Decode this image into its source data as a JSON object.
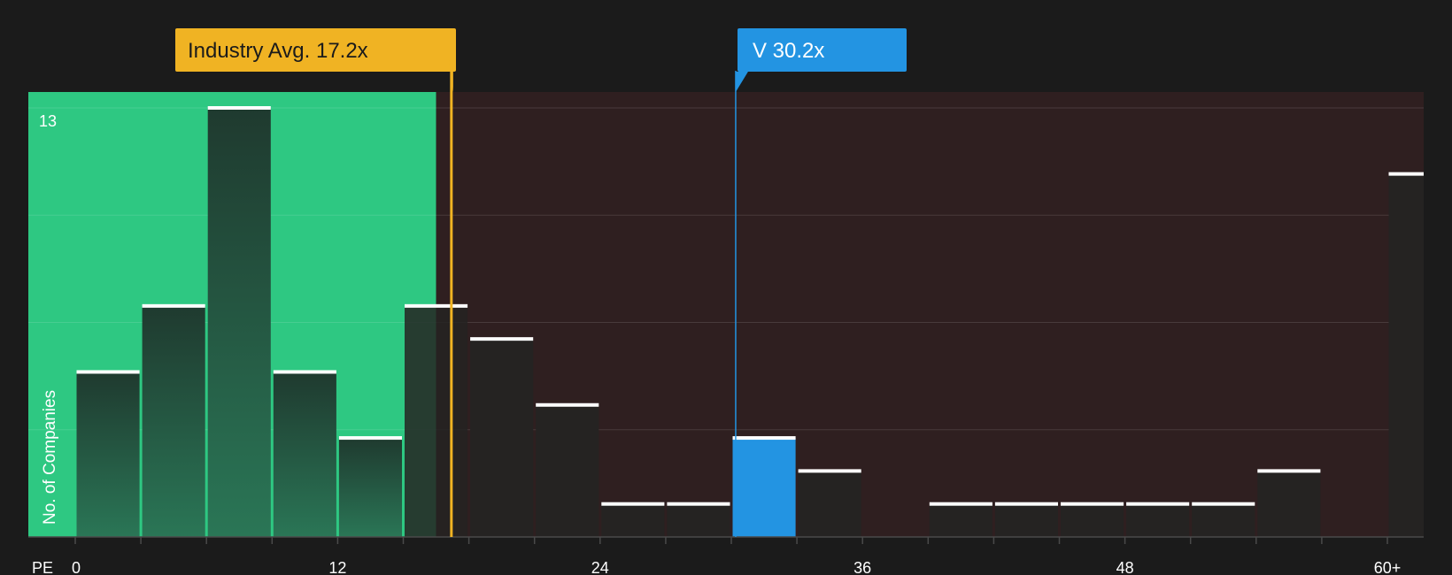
{
  "chart_data": {
    "type": "bar",
    "title": "",
    "xlabel": "PE",
    "ylabel": "No. of Companies",
    "ylim": [
      0,
      13
    ],
    "y_max_label": "13",
    "x_ticks": [
      "0",
      "12",
      "24",
      "36",
      "48",
      "60+"
    ],
    "bin_width": 3,
    "bins": [
      {
        "x_start": 0,
        "value": 5
      },
      {
        "x_start": 3,
        "value": 7
      },
      {
        "x_start": 6,
        "value": 13
      },
      {
        "x_start": 9,
        "value": 5
      },
      {
        "x_start": 12,
        "value": 3
      },
      {
        "x_start": 15,
        "value": 7
      },
      {
        "x_start": 18,
        "value": 6
      },
      {
        "x_start": 21,
        "value": 4
      },
      {
        "x_start": 24,
        "value": 1
      },
      {
        "x_start": 27,
        "value": 1
      },
      {
        "x_start": 30,
        "value": 3,
        "highlight": true
      },
      {
        "x_start": 33,
        "value": 2
      },
      {
        "x_start": 36,
        "value": 0
      },
      {
        "x_start": 39,
        "value": 1
      },
      {
        "x_start": 42,
        "value": 1
      },
      {
        "x_start": 45,
        "value": 1
      },
      {
        "x_start": 48,
        "value": 1
      },
      {
        "x_start": 51,
        "value": 1
      },
      {
        "x_start": 54,
        "value": 2
      },
      {
        "x_start": 57,
        "value": 0
      },
      {
        "x_start": 60,
        "value": 11
      }
    ],
    "fair_range_max": 16.5,
    "markers": [
      {
        "label": "Industry Avg. 17.2x",
        "value": 17.2,
        "color": "#f0b323"
      },
      {
        "label": "V 30.2x",
        "value": 30.2,
        "color": "#2394e2"
      }
    ],
    "colors": {
      "background": "#1b1b1b",
      "fair_zone": "#2ec882",
      "expensive_zone": "#2f1f20",
      "bar": "#252322",
      "highlight_bar": "#2394e2",
      "bar_cap": "#ffffff"
    }
  }
}
